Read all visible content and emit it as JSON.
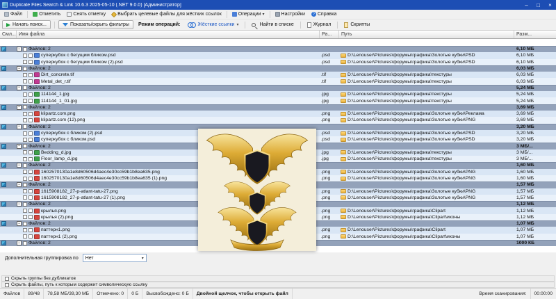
{
  "window": {
    "title": "Duplicate Files Search & Link 10.6.3 2025-05-10 (.NET 9.0.0) [Администратор]",
    "minimize": "–",
    "maximize": "□",
    "close": "×"
  },
  "menu": {
    "items": [
      {
        "label": "Файл"
      },
      {
        "label": "Отметить"
      },
      {
        "label": "Снять отметку"
      },
      {
        "label": "Выбрать целевые файлы для жёстких ссылок"
      },
      {
        "label": "Операции"
      },
      {
        "label": "Настройки"
      },
      {
        "label": "Справка"
      }
    ]
  },
  "toolbar": {
    "start": "Начать поиск...",
    "filters": "Показать/скрыть фильтры",
    "mode_label": "Режим операций:",
    "mode_value": "Жёсткие ссылки",
    "find": "Найти в списке",
    "journal": "Журнал",
    "scripts": "Скрипты"
  },
  "columns": {
    "sml": "Смл...",
    "name": "Имя файла",
    "ext": "Ра...",
    "path": "Путь",
    "size": "Разм..."
  },
  "list": {
    "icon_colors": {
      ".psd": "#4a7fd8",
      ".tif": "#c23a92",
      ".jpg": "#3fa14a",
      ".png": "#d6453e"
    },
    "groups": [
      {
        "label": "Файлов: 2",
        "size": "6,10 МБ",
        "files": [
          {
            "name": "суперкубок с бегущим бликом.psd",
            "ext": ".psd",
            "path": "D:\\Lenouser\\Pictures\\форумы\\графика\\Золотые кубки\\PSD",
            "size": "6,10 МБ"
          },
          {
            "name": "суперкубок с бегущим бликом (2).psd",
            "ext": ".psd",
            "path": "D:\\Lenouser\\Pictures\\форумы\\графика\\Золотые кубки\\PSD",
            "size": "6,10 МБ"
          }
        ]
      },
      {
        "label": "Файлов: 2",
        "size": "6,03 МБ",
        "files": [
          {
            "name": "Dirt_concrete.tif",
            "ext": ".tif",
            "path": "D:\\Lenouser\\Pictures\\форумы\\графика\\текстуры",
            "size": "6,03 МБ"
          },
          {
            "name": "Metal_det_r.tif",
            "ext": ".tif",
            "path": "D:\\Lenouser\\Pictures\\форумы\\графика\\текстуры",
            "size": "6,03 МБ"
          }
        ]
      },
      {
        "label": "Файлов: 2",
        "size": "5,24 МБ",
        "files": [
          {
            "name": "114144_1.jpg",
            "ext": ".jpg",
            "path": "D:\\Lenouser\\Pictures\\форумы\\графика\\текстуры",
            "size": "5,24 МБ"
          },
          {
            "name": "114144_1_01.jpg",
            "ext": ".jpg",
            "path": "D:\\Lenouser\\Pictures\\форумы\\графика\\текстуры",
            "size": "5,24 МБ"
          }
        ]
      },
      {
        "label": "Файлов: 2",
        "size": "3,69 МБ",
        "files": [
          {
            "name": "klipartz.com.png",
            "ext": ".png",
            "path": "D:\\Lenouser\\Pictures\\форумы\\графика\\Золотые кубки\\Реклама",
            "size": "3,69 МБ"
          },
          {
            "name": "klipartz.com (12).png",
            "ext": ".png",
            "path": "D:\\Lenouser\\Pictures\\форумы\\графика\\Золотые кубки\\PNG",
            "size": "3,69 МБ"
          }
        ]
      },
      {
        "label": "Файлов: 2",
        "size": "3,20 МБ",
        "files": [
          {
            "name": "суперкубок с бликом (2).psd",
            "ext": ".psd",
            "path": "D:\\Lenouser\\Pictures\\форумы\\графика\\Золотые кубки\\PSD",
            "size": "3,20 МБ"
          },
          {
            "name": "суперкубок с бликом.psd",
            "ext": ".psd",
            "path": "D:\\Lenouser\\Pictures\\форумы\\графика\\Золотые кубки\\PSD",
            "size": "3,20 МБ"
          }
        ]
      },
      {
        "label": "Файлов: 2",
        "size": "3 МБ/...",
        "files": [
          {
            "name": "Bedding_d.jpg",
            "ext": ".jpg",
            "path": "D:\\Lenouser\\Pictures\\форумы\\графика\\текстуры",
            "size": "3 МБ/..."
          },
          {
            "name": "Floor_lamp_d.jpg",
            "ext": ".jpg",
            "path": "D:\\Lenouser\\Pictures\\форумы\\графика\\текстуры",
            "size": "3 МБ/..."
          }
        ]
      },
      {
        "label": "Файлов: 2",
        "size": "1,60 МБ",
        "files": [
          {
            "name": "1602570130a1e8d60506d4aec4e30cc59b1b8ea635.png",
            "ext": ".png",
            "path": "D:\\Lenouser\\Pictures\\форумы\\графика\\Золотые кубки\\PNG",
            "size": "1,60 МБ"
          },
          {
            "name": "1602570130a1e8d60506d4aec4e30cc59b1b8ea635 (1).png",
            "ext": ".png",
            "path": "D:\\Lenouser\\Pictures\\форумы\\графика\\Золотые кубки\\PNG",
            "size": "1,60 МБ"
          }
        ]
      },
      {
        "label": "Файлов: 2",
        "size": "1,57 МБ",
        "files": [
          {
            "name": "1615908182_27-p-atlant-tatu-27.png",
            "ext": ".png",
            "path": "D:\\Lenouser\\Pictures\\форумы\\графика\\Золотые кубки\\PNG",
            "size": "1,57 МБ"
          },
          {
            "name": "1615908182_27-p-atlant-tatu-27 (1).png",
            "ext": ".png",
            "path": "D:\\Lenouser\\Pictures\\форумы\\графика\\Золотые кубки\\PNG",
            "size": "1,57 МБ"
          }
        ]
      },
      {
        "label": "Файлов: 2",
        "size": "1,12 МБ",
        "files": [
          {
            "name": "крылья.png",
            "ext": ".png",
            "path": "D:\\Lenouser\\Pictures\\форумы\\графика\\Clipart",
            "size": "1,12 МБ"
          },
          {
            "name": "крылья (2).png",
            "ext": ".png",
            "path": "D:\\Lenouser\\Pictures\\форумы\\графика\\Clipart\\иконы",
            "size": "1,12 МБ"
          }
        ]
      },
      {
        "label": "Файлов: 2",
        "size": "1,07 МБ",
        "files": [
          {
            "name": "паттерн1.png",
            "ext": ".png",
            "path": "D:\\Lenouser\\Pictures\\форумы\\графика\\Clipart",
            "size": "1,07 МБ"
          },
          {
            "name": "паттерн1 (2).png",
            "ext": ".png",
            "path": "D:\\Lenouser\\Pictures\\форумы\\графика\\Clipart\\иконы",
            "size": "1,07 МБ"
          }
        ]
      },
      {
        "label": "Файлов: 2",
        "size": "1000 КБ",
        "files": []
      }
    ]
  },
  "grouping": {
    "label": "Дополнительная группировка по",
    "value": "Нет"
  },
  "options": [
    {
      "label": "Скрыть группы без дубликатов"
    },
    {
      "label": "Скрыть файлы, путь к которым содержит символическую ссылку"
    }
  ],
  "status": {
    "files_label": "Файлов",
    "files": "89/48",
    "sizes": "78,58 МБ/39,30 МБ",
    "marked": "Отмечено: 0",
    "marked_size": "0 Б",
    "freed": "Высвобождено: 0 Б",
    "hint": "Двойной щелчок, чтобы открыть файл",
    "scan_label": "Время сканирования:",
    "scan_time": "00:00:00"
  }
}
